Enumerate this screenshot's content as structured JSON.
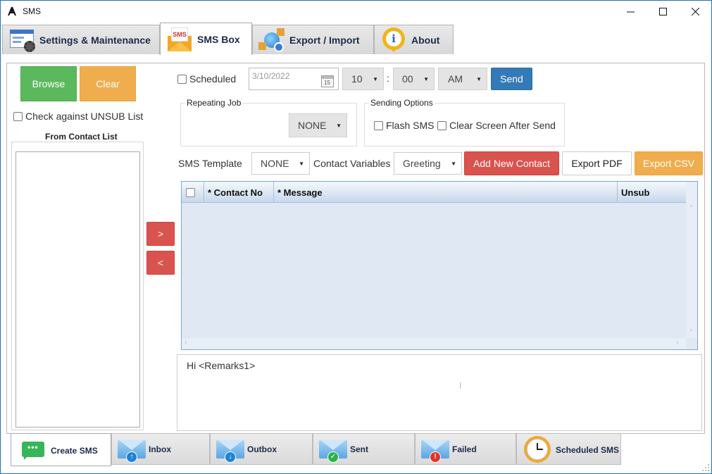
{
  "window": {
    "title": "SMS",
    "minimize": "—",
    "maximize": "☐",
    "close": "✕"
  },
  "tabs": [
    {
      "label": "Settings & Maintenance",
      "icon": "settings-gear-icon"
    },
    {
      "label": "SMS Box",
      "icon": "sms-envelope-icon",
      "icon_text": "SMS"
    },
    {
      "label": "Export / Import",
      "icon": "globe-export-icon"
    },
    {
      "label": "About",
      "icon": "info-icon",
      "icon_text": "i"
    }
  ],
  "left": {
    "browse": "Browse",
    "clear": "Clear",
    "unsub_check": "Check against UNSUB List",
    "contact_list_title": "From Contact List",
    "move_right": ">",
    "move_left": "<"
  },
  "schedule": {
    "scheduled_label": "Scheduled",
    "date_value": "3/10/2022",
    "calendar_day": "15",
    "hour": "10",
    "time_sep": ":",
    "minute": "00",
    "ampm": "AM",
    "send": "Send"
  },
  "repeating_job": {
    "title": "Repeating Job",
    "value": "NONE"
  },
  "sending_options": {
    "title": "Sending Options",
    "flash_sms": "Flash SMS",
    "clear_after_send": "Clear Screen After Send"
  },
  "toolbar": {
    "template_label": "SMS Template",
    "template_value": "NONE",
    "variables_label": "Contact Variables",
    "variables_value": "Greeting",
    "add_contact": "Add New Contact",
    "export_pdf": "Export PDF",
    "export_csv": "Export CSV"
  },
  "grid": {
    "columns": [
      "* Contact No",
      "* Message",
      "Unsub"
    ],
    "rows": []
  },
  "message": {
    "text": "Hi <Remarks1>"
  },
  "bottom_tabs": [
    {
      "label": "Create SMS",
      "icon": "chat-bubble-icon"
    },
    {
      "label": "Inbox",
      "icon": "inbox-envelope-icon"
    },
    {
      "label": "Outbox",
      "icon": "outbox-envelope-icon"
    },
    {
      "label": "Sent",
      "icon": "sent-envelope-icon"
    },
    {
      "label": "Failed",
      "icon": "failed-envelope-icon"
    },
    {
      "label": "Scheduled SMS",
      "icon": "clock-icon"
    }
  ],
  "colors": {
    "green": "#5cb85c",
    "orange": "#f0ad4e",
    "red": "#d9534f",
    "blue": "#337ab7",
    "grid_bg": "#dfe8f3"
  }
}
